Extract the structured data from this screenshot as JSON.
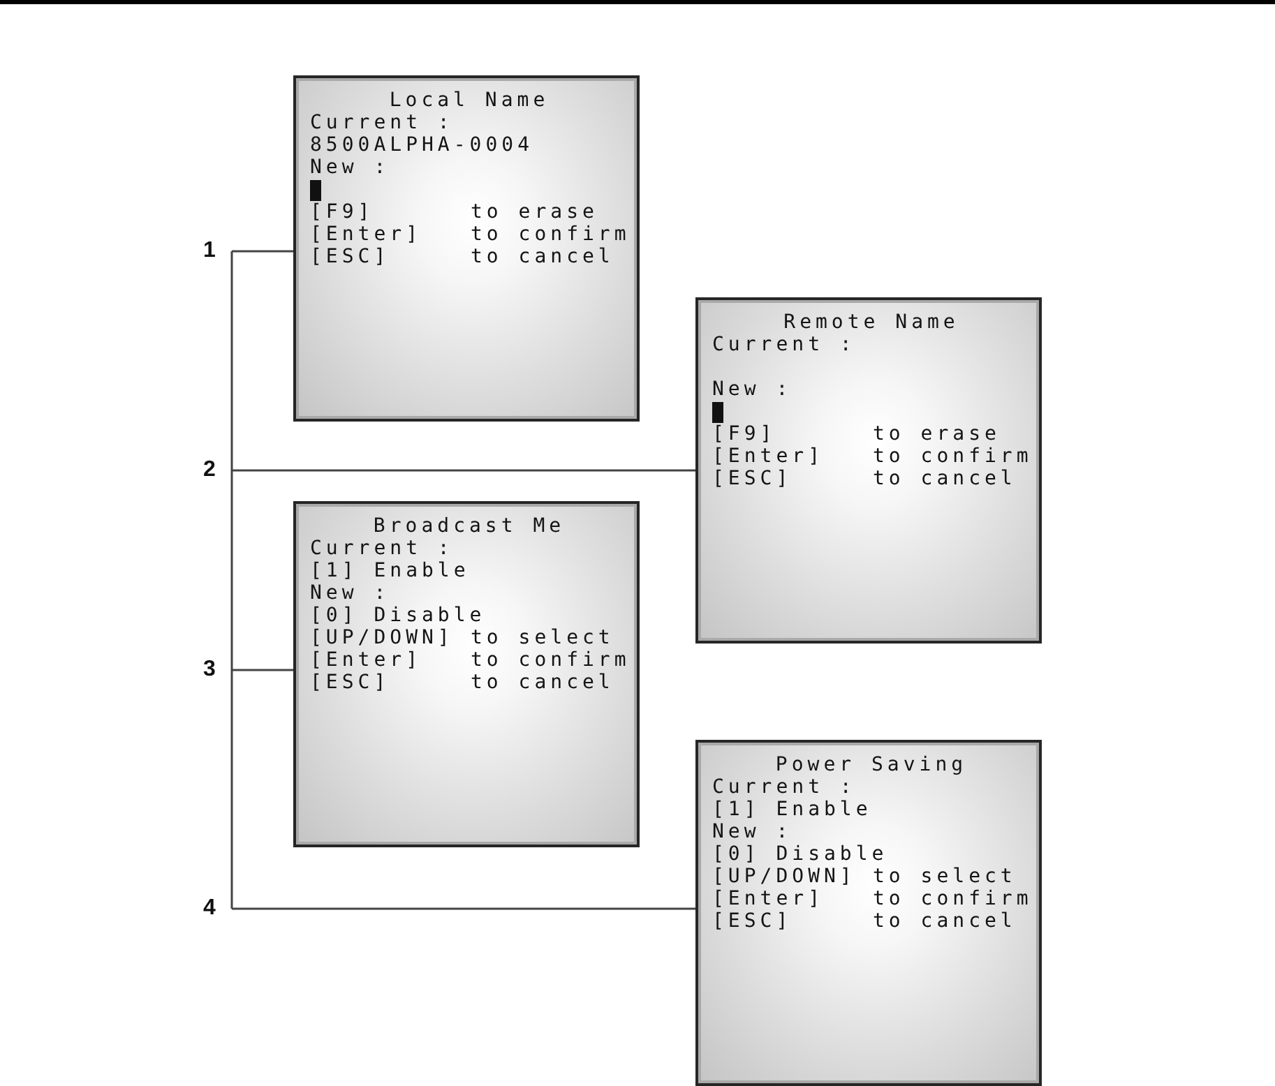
{
  "screens": [
    {
      "callout": "1",
      "title": "Local Name",
      "current_label": "Current :",
      "current_value": "8500ALPHA-0004",
      "new_label": "New :",
      "new_value": {
        "kind": "cursor"
      },
      "commands": [
        {
          "key": "[F9]",
          "action": "to erase"
        },
        {
          "key": "[Enter]",
          "action": "to confirm"
        },
        {
          "key": "[ESC]",
          "action": "to cancel"
        }
      ]
    },
    {
      "callout": "2",
      "title": "Remote Name",
      "current_label": "Current :",
      "new_label": "New :",
      "new_value": {
        "kind": "cursor"
      },
      "commands": [
        {
          "key": "[F9]",
          "action": "to erase"
        },
        {
          "key": "[Enter]",
          "action": "to confirm"
        },
        {
          "key": "[ESC]",
          "action": "to cancel"
        }
      ]
    },
    {
      "callout": "3",
      "title": "Broadcast Me",
      "current_label": "Current :",
      "current_value": "[1] Enable",
      "new_label": "New :",
      "new_value": {
        "kind": "text",
        "text": "[0] Disable"
      },
      "commands": [
        {
          "key": "[UP/DOWN]",
          "action": "to select"
        },
        {
          "key": "[Enter]",
          "action": "to confirm"
        },
        {
          "key": "[ESC]",
          "action": "to cancel"
        }
      ]
    },
    {
      "callout": "4",
      "title": "Power Saving",
      "current_label": "Current :",
      "current_value": "[1] Enable",
      "new_label": "New :",
      "new_value": {
        "kind": "text",
        "text": "[0] Disable"
      },
      "commands": [
        {
          "key": "[UP/DOWN]",
          "action": "to select"
        },
        {
          "key": "[Enter]",
          "action": "to confirm"
        },
        {
          "key": "[ESC]",
          "action": "to cancel"
        }
      ]
    }
  ]
}
